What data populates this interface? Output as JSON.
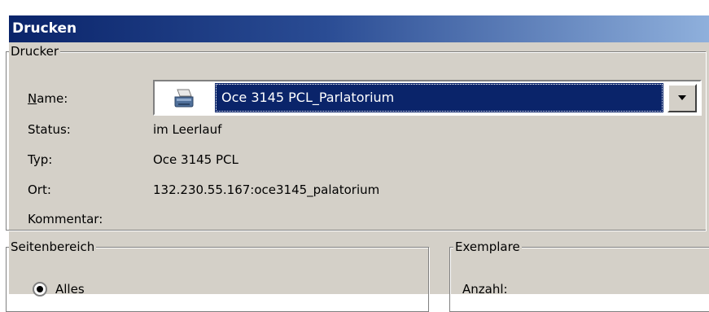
{
  "window": {
    "title": "Drucken"
  },
  "printer_group": {
    "legend": "Drucker",
    "name_label": "Name:",
    "name_label_accesskey": "N",
    "name_label_rest": "ame:",
    "selected_printer": "Oce 3145 PCL_Parlatorium",
    "status_label": "Status:",
    "status_value": "im Leerlauf",
    "type_label": "Typ:",
    "type_value": "Oce 3145 PCL",
    "location_label": "Ort:",
    "location_value": "132.230.55.167:oce3145_palatorium",
    "comment_label": "Kommentar:",
    "comment_value": ""
  },
  "page_range_group": {
    "legend": "Seitenbereich",
    "option_all": "Alles"
  },
  "copies_group": {
    "legend": "Exemplare",
    "count_label": "Anzahl:"
  },
  "colors": {
    "title_start": "#0a246a",
    "title_end": "#8fb0dc",
    "dialog_bg": "#d4d0c8",
    "selection": "#0a246a"
  },
  "icons": {
    "printer": "printer-icon",
    "dropdown": "chevron-down-icon"
  }
}
